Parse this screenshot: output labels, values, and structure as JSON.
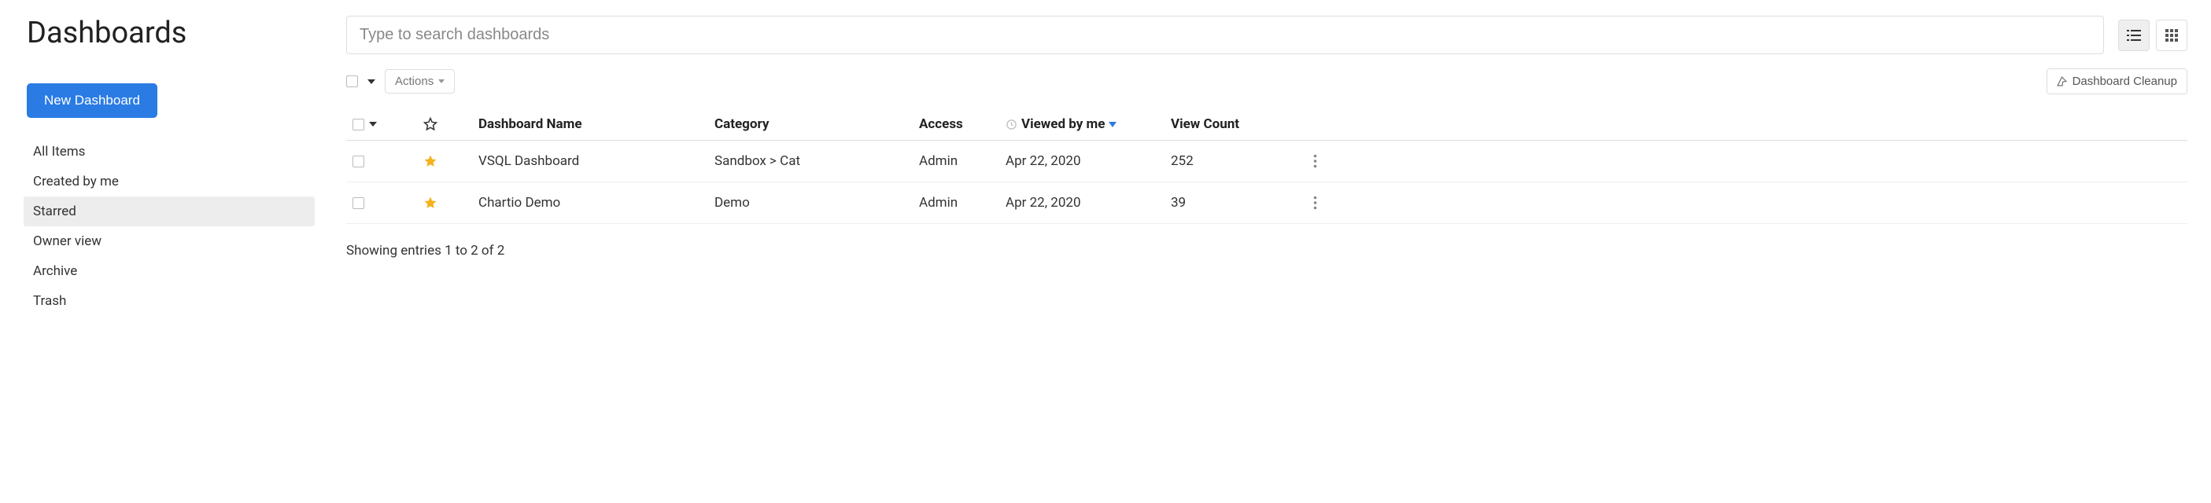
{
  "page_title": "Dashboards",
  "new_dashboard_label": "New Dashboard",
  "sidebar": {
    "items": [
      {
        "label": "All Items",
        "active": false
      },
      {
        "label": "Created by me",
        "active": false
      },
      {
        "label": "Starred",
        "active": true
      },
      {
        "label": "Owner view",
        "active": false
      },
      {
        "label": "Archive",
        "active": false
      },
      {
        "label": "Trash",
        "active": false
      }
    ]
  },
  "search_placeholder": "Type to search dashboards",
  "actions_label": "Actions",
  "cleanup_label": "Dashboard Cleanup",
  "columns": {
    "name": "Dashboard Name",
    "category": "Category",
    "access": "Access",
    "viewed": "Viewed by me",
    "view_count": "View Count"
  },
  "rows": [
    {
      "name": "VSQL Dashboard",
      "category": "Sandbox > Cat",
      "access": "Admin",
      "viewed": "Apr 22, 2020",
      "view_count": "252"
    },
    {
      "name": "Chartio Demo",
      "category": "Demo",
      "access": "Admin",
      "viewed": "Apr 22, 2020",
      "view_count": "39"
    }
  ],
  "footer": "Showing entries 1 to 2 of 2"
}
